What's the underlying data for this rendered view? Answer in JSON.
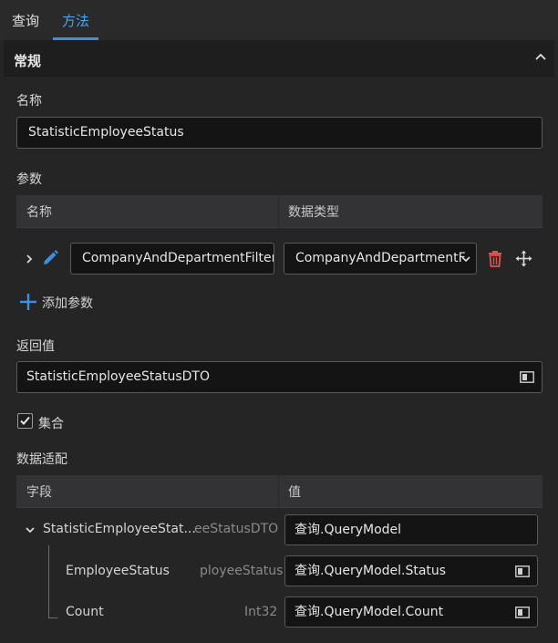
{
  "tabs": [
    {
      "label": "查询"
    },
    {
      "label": "方法"
    }
  ],
  "section": {
    "title": "常规"
  },
  "name_field": {
    "label": "名称",
    "value": "StatisticEmployeeStatus"
  },
  "params": {
    "label": "参数",
    "col_name": "名称",
    "col_type": "数据类型",
    "rows": [
      {
        "name": "CompanyAndDepartmentFilter",
        "type": "CompanyAndDepartmentF"
      }
    ],
    "add_label": "添加参数"
  },
  "return_value": {
    "label": "返回值",
    "value": "StatisticEmployeeStatusDTO"
  },
  "collection": {
    "label": "集合",
    "checked": true
  },
  "mapping": {
    "label": "数据适配",
    "col_field": "字段",
    "col_value": "值",
    "rows": [
      {
        "field": "StatisticEmployeeStat...",
        "type": "eeStatusDTO",
        "value": "查询.QueryModel"
      },
      {
        "field": "EmployeeStatus",
        "type": "ployeeStatus",
        "value": "查询.QueryModel.Status"
      },
      {
        "field": "Count",
        "type": "Int32",
        "value": "查询.QueryModel.Count"
      }
    ]
  },
  "colors": {
    "accent": "#3d8fe0",
    "delete": "#e05252",
    "background": "#252526"
  }
}
